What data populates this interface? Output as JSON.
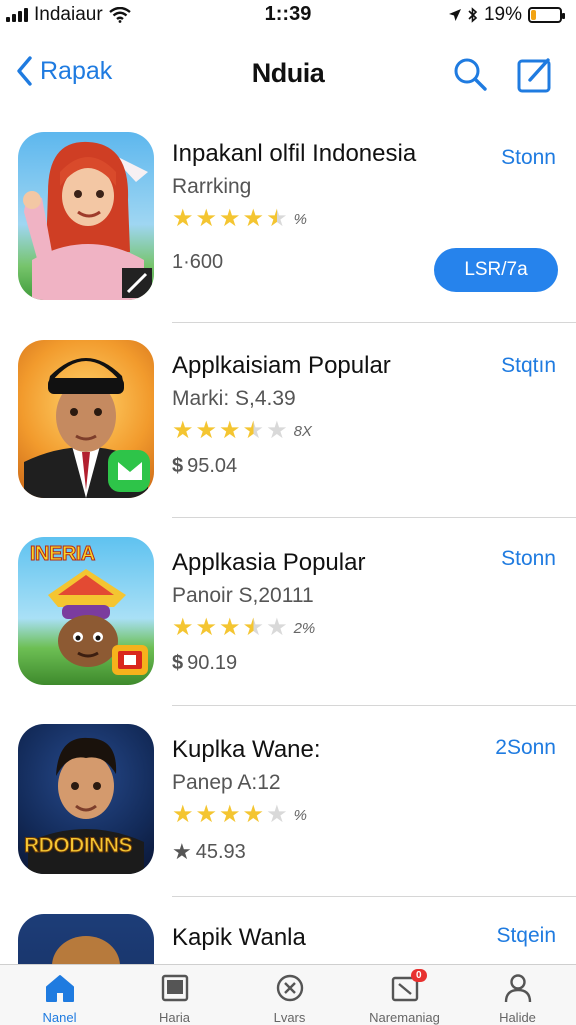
{
  "status": {
    "carrier": "Indaiaur",
    "time": "1::39",
    "battery": "19%",
    "battery_level": 0.19
  },
  "nav": {
    "back_label": "Rapak",
    "title": "Nduia"
  },
  "apps": [
    {
      "title": "Inpakanl olfil Indonesia",
      "subtitle": "Rarrking",
      "rating_text": "%",
      "rating": 4.5,
      "price": "1·600",
      "action": "Stonn",
      "button": "LSR/7a"
    },
    {
      "title": "Applkaisiam Popular",
      "subtitle": "Marki: S,4.39",
      "rating_text": "8X",
      "rating": 3.5,
      "price": "95.04",
      "action": "Stqtın"
    },
    {
      "title": "Applkasia Popular",
      "subtitle": "Panoir S,20111",
      "rating_text": "2%",
      "rating": 3.5,
      "price": "90.19",
      "action": "Stonn"
    },
    {
      "title": "Kuplka Wane:",
      "subtitle": "Panep A:12",
      "rating_text": "%",
      "rating": 4,
      "price": "45.93",
      "action": "2Sonn"
    },
    {
      "title": "Kapik Wanla",
      "subtitle": "",
      "rating_text": "",
      "rating": 0,
      "price": "",
      "action": "Stqein"
    }
  ],
  "thumb_labels": {
    "app3": "INERIA",
    "app4": "RDODINNS"
  },
  "tabs": [
    {
      "label": "Nanel",
      "icon": "home-icon",
      "active": true
    },
    {
      "label": "Haria",
      "icon": "book-icon"
    },
    {
      "label": "Lvars",
      "icon": "close-circle-icon"
    },
    {
      "label": "Naremaniag",
      "icon": "updates-icon",
      "badge": "0"
    },
    {
      "label": "Halide",
      "icon": "person-icon"
    }
  ],
  "colors": {
    "accent": "#1f7be0",
    "star": "#f4c531",
    "button": "#2683ec",
    "badge": "#e8312f"
  }
}
